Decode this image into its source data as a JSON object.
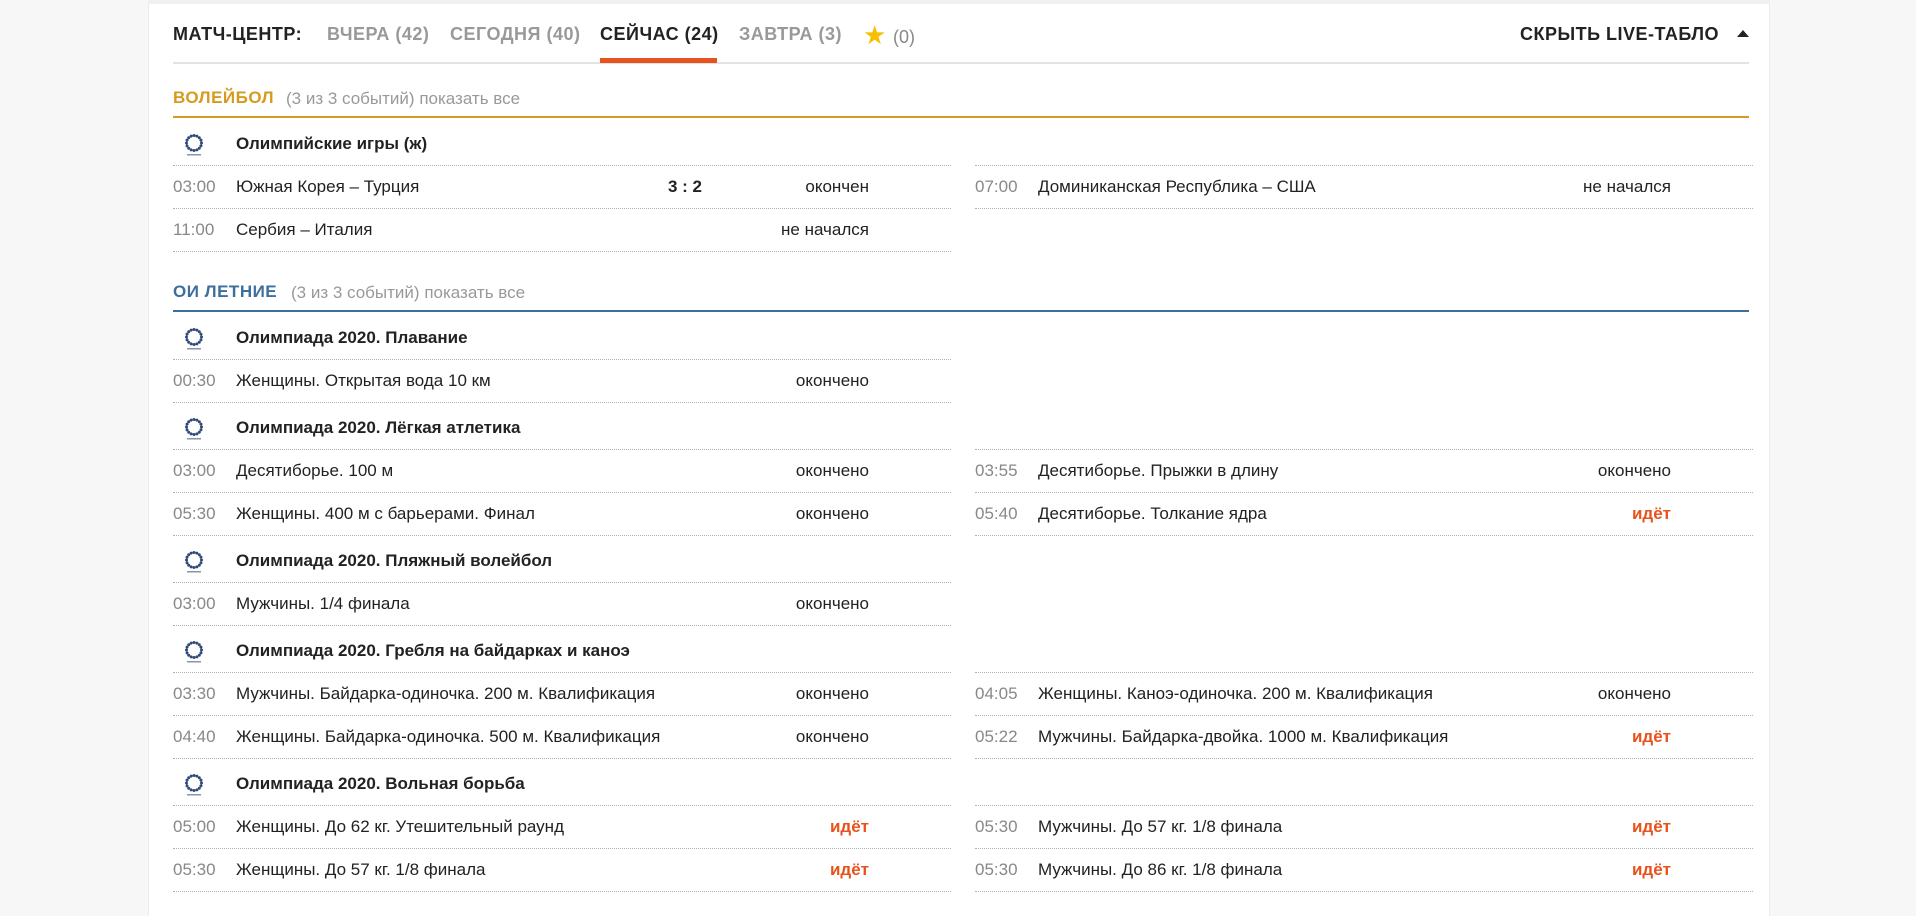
{
  "tabs": {
    "brand": "МАТЧ-ЦЕНТР:",
    "items": [
      {
        "label": "ВЧЕРА (42)"
      },
      {
        "label": "СЕГОДНЯ (40)"
      },
      {
        "label": "СЕЙЧАС (24)"
      },
      {
        "label": "ЗАВТРА (3)"
      }
    ],
    "favorites_icon": "star-icon",
    "favorites_count": "(0)",
    "hide_label": "СКРЫТЬ LIVE-ТАБЛО",
    "accent_color": "#e8521c"
  },
  "sections": [
    {
      "sport": "ВОЛЕЙБОЛ",
      "color": "#d69a1e",
      "info_prefix": "(3 из 3 событий)",
      "show_all": "показать все",
      "leagues": [
        {
          "name": "Олимпийские игры (ж)",
          "icon": "olympic-logo-icon",
          "left": [
            {
              "time": "03:00",
              "title": "Южная Корея – Турция",
              "score": "3 : 2",
              "status": "окончен",
              "live": false
            },
            {
              "time": "11:00",
              "title": "Сербия – Италия",
              "score": "",
              "status": "не начался",
              "live": false
            }
          ],
          "right": [
            {
              "time": "07:00",
              "title": "Доминиканская Республика – США",
              "score": "",
              "status": "не начался",
              "live": false
            }
          ]
        }
      ]
    },
    {
      "sport": "ОИ ЛЕТНИЕ",
      "color": "#3d6f9c",
      "info_prefix": "(3 из 3 событий)",
      "show_all": "показать все",
      "leagues": [
        {
          "name": "Олимпиада 2020. Плавание",
          "icon": "olympic-logo-icon",
          "left": [
            {
              "time": "00:30",
              "title": "Женщины. Открытая вода 10 км",
              "score": "",
              "status": "окончено",
              "live": false
            }
          ],
          "right": []
        },
        {
          "name": "Олимпиада 2020. Лёгкая атлетика",
          "icon": "olympic-logo-icon",
          "left": [
            {
              "time": "03:00",
              "title": "Десятиборье. 100 м",
              "score": "",
              "status": "окончено",
              "live": false
            },
            {
              "time": "05:30",
              "title": "Женщины. 400 м с барьерами. Финал",
              "score": "",
              "status": "окончено",
              "live": false
            }
          ],
          "right": [
            {
              "time": "03:55",
              "title": "Десятиборье. Прыжки в длину",
              "score": "",
              "status": "окончено",
              "live": false
            },
            {
              "time": "05:40",
              "title": "Десятиборье. Толкание ядра",
              "score": "",
              "status": "идёт",
              "live": true
            }
          ]
        },
        {
          "name": "Олимпиада 2020. Пляжный волейбол",
          "icon": "olympic-logo-icon",
          "left": [
            {
              "time": "03:00",
              "title": "Мужчины. 1/4 финала",
              "score": "",
              "status": "окончено",
              "live": false
            }
          ],
          "right": []
        },
        {
          "name": "Олимпиада 2020. Гребля на байдарках и каноэ",
          "icon": "olympic-logo-icon",
          "left": [
            {
              "time": "03:30",
              "title": "Мужчины. Байдарка-одиночка. 200 м. Квалификация",
              "score": "",
              "status": "окончено",
              "live": false
            },
            {
              "time": "04:40",
              "title": "Женщины. Байдарка-одиночка. 500 м. Квалификация",
              "score": "",
              "status": "окончено",
              "live": false
            }
          ],
          "right": [
            {
              "time": "04:05",
              "title": "Женщины. Каноэ-одиночка. 200 м. Квалификация",
              "score": "",
              "status": "окончено",
              "live": false
            },
            {
              "time": "05:22",
              "title": "Мужчины. Байдарка-двойка. 1000 м. Квалификация",
              "score": "",
              "status": "идёт",
              "live": true
            }
          ]
        },
        {
          "name": "Олимпиада 2020. Вольная борьба",
          "icon": "olympic-logo-icon",
          "left": [
            {
              "time": "05:00",
              "title": "Женщины. До 62 кг. Утешительный раунд",
              "score": "",
              "status": "идёт",
              "live": true
            },
            {
              "time": "05:30",
              "title": "Женщины. До 57 кг. 1/8 финала",
              "score": "",
              "status": "идёт",
              "live": true
            }
          ],
          "right": [
            {
              "time": "05:30",
              "title": "Мужчины. До 57 кг. 1/8 финала",
              "score": "",
              "status": "идёт",
              "live": true
            },
            {
              "time": "05:30",
              "title": "Мужчины. До 86 кг. 1/8 финала",
              "score": "",
              "status": "идёт",
              "live": true
            }
          ]
        }
      ]
    }
  ]
}
